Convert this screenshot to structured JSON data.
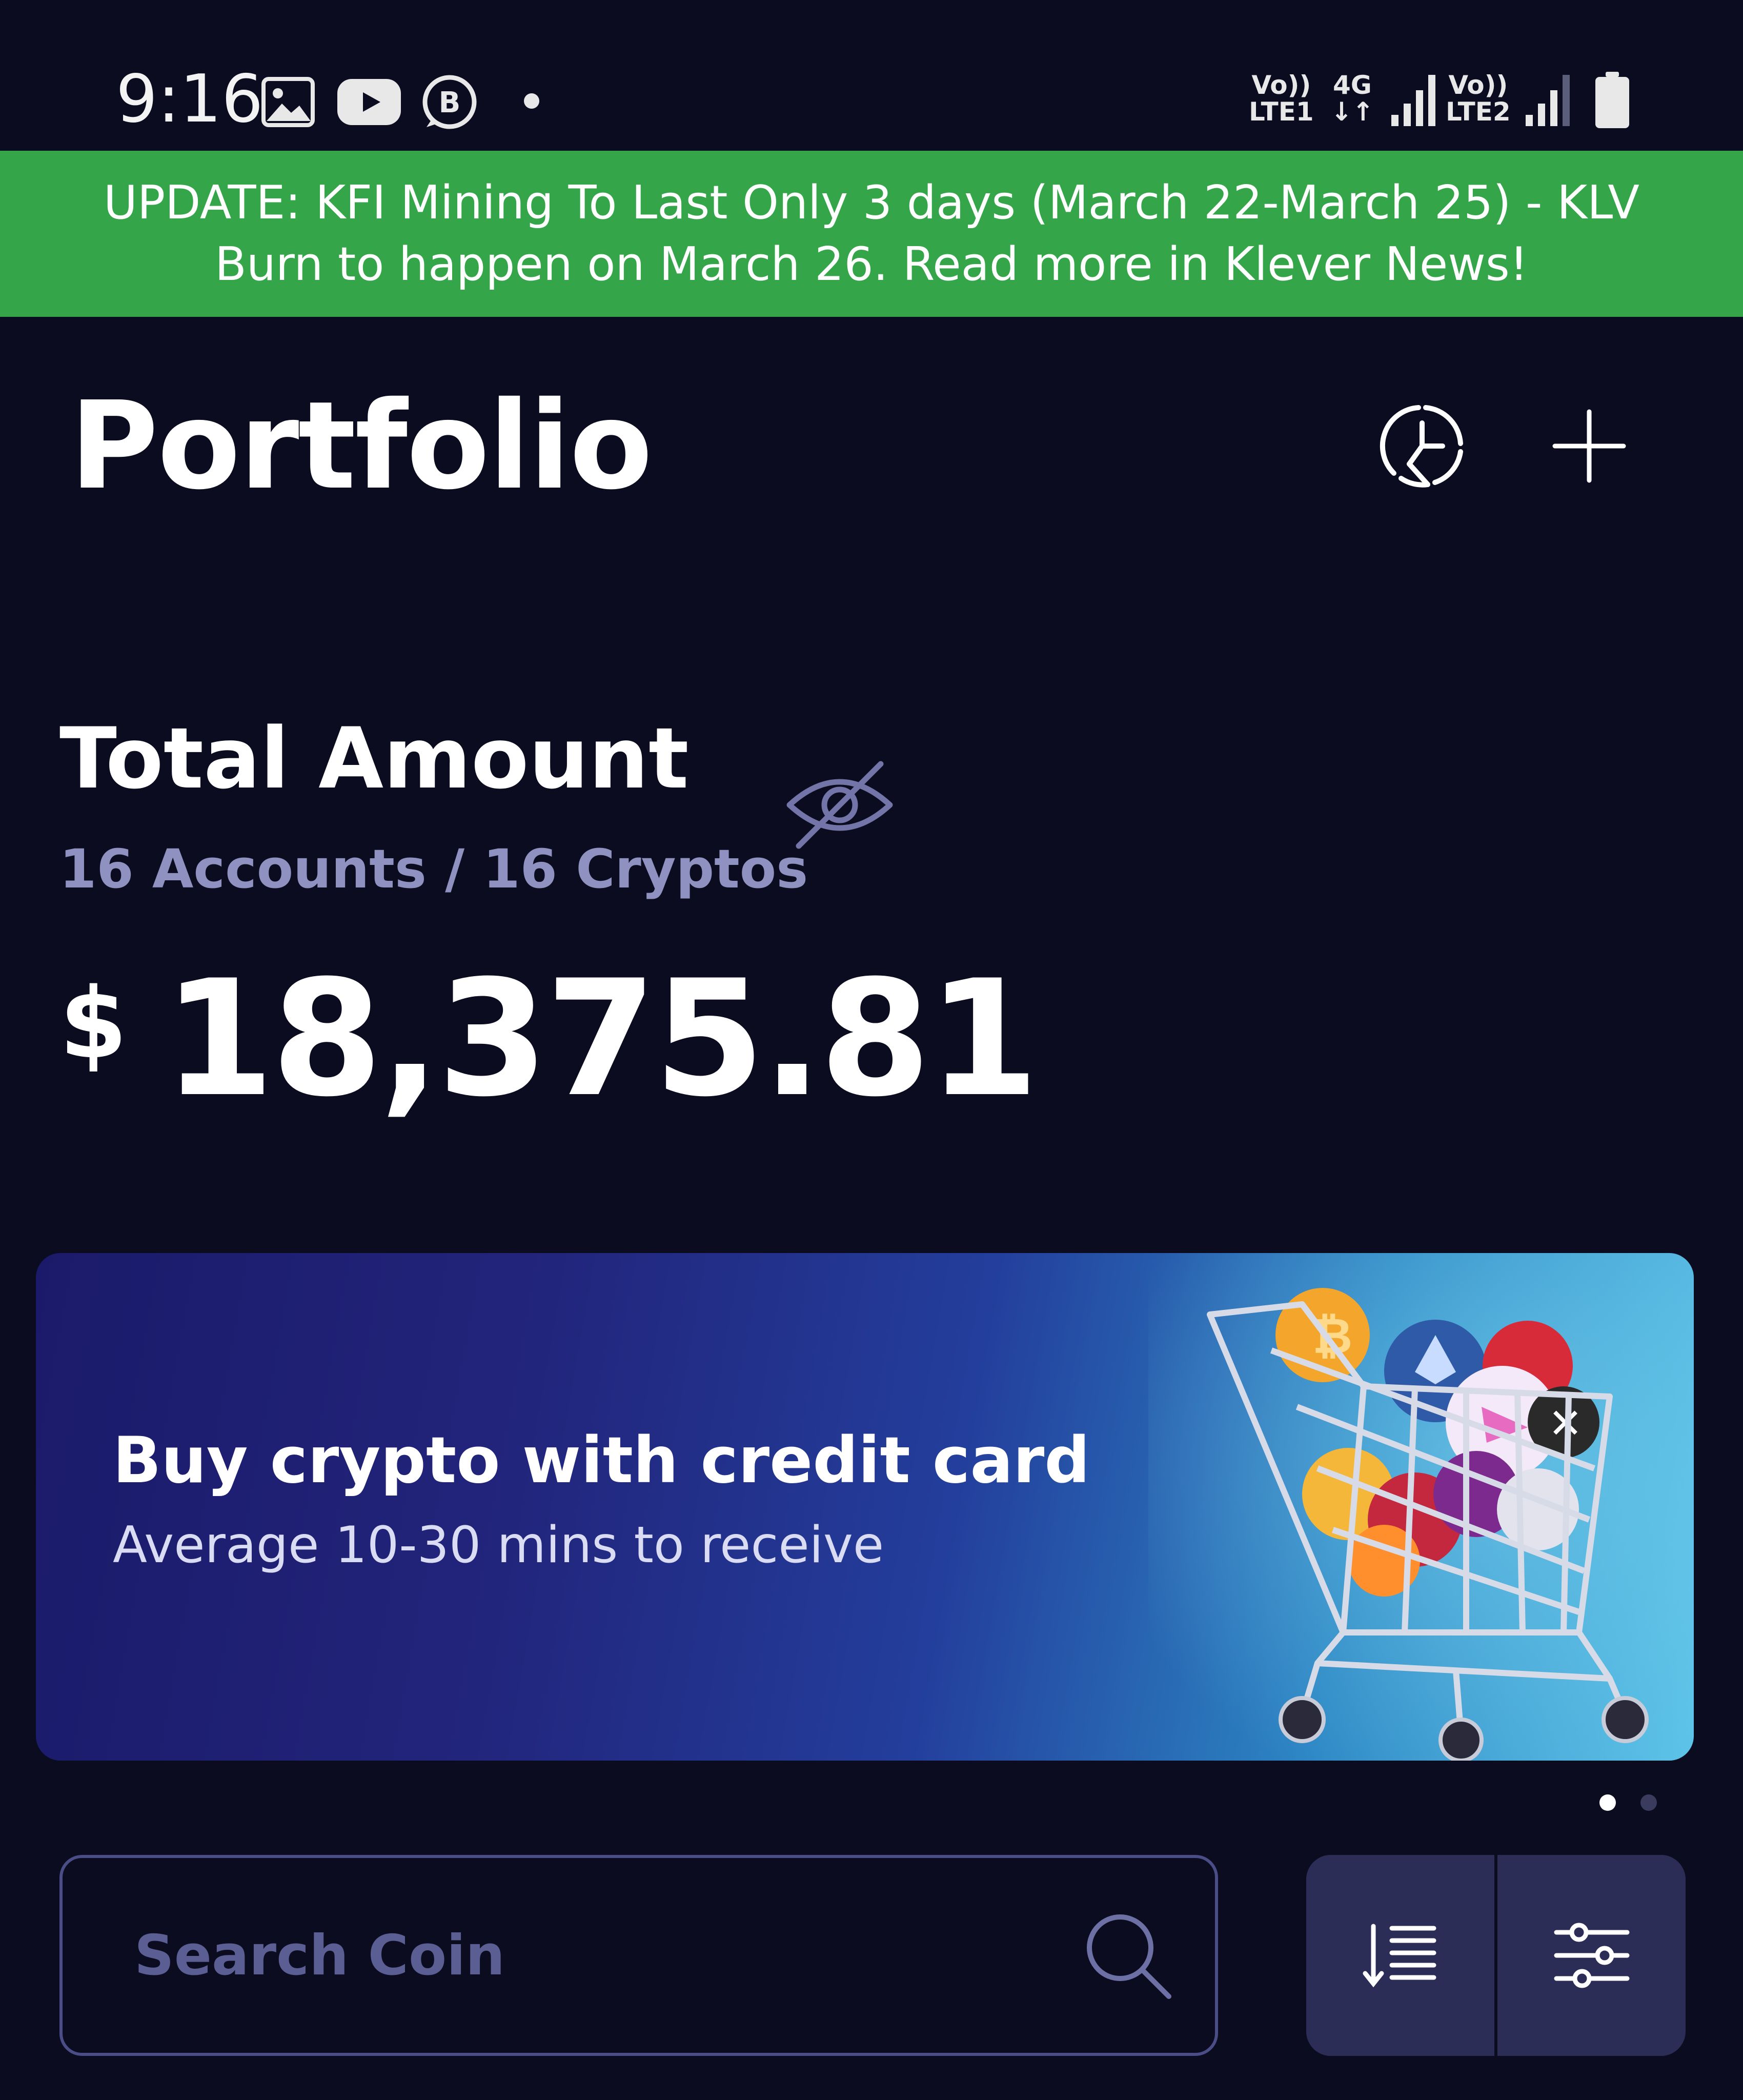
{
  "status_bar": {
    "time": "9:16",
    "net1_top": "Vo))",
    "net1_bottom": "LTE1",
    "net2_top": "4G",
    "net2_bottom": "↓↑",
    "net3_top": "Vo))",
    "net3_bottom": "LTE2",
    "icons": [
      "gallery-icon",
      "youtube-icon",
      "b-app-icon",
      "notification-dot",
      "signal-icon",
      "signal-icon",
      "battery-icon"
    ]
  },
  "announcement": {
    "text": "UPDATE: KFI Mining To Last Only 3 days (March 22-March 25) - KLV Burn to happen on March 26. Read more in Klever News!",
    "background": "#34a649"
  },
  "header": {
    "title": "Portfolio",
    "icons": [
      "pie-chart-icon",
      "plus-icon"
    ]
  },
  "summary": {
    "label": "Total Amount",
    "accounts": "16 Accounts / 16 Cryptos",
    "currency": "$",
    "amount": "18,375.81"
  },
  "promo": {
    "title": "Buy crypto with credit card",
    "subtitle": "Average 10-30 mins to receive",
    "slides_total": 2,
    "active_slide": 1
  },
  "search": {
    "placeholder": "Search Coin",
    "value": ""
  },
  "toolbar": {
    "icons": [
      "sort-icon",
      "filter-sliders-icon"
    ]
  },
  "colors": {
    "background": "#0b0c1f",
    "muted_text": "#8f91c0",
    "button_bg": "#2b2d56",
    "border": "#4a4d86"
  }
}
